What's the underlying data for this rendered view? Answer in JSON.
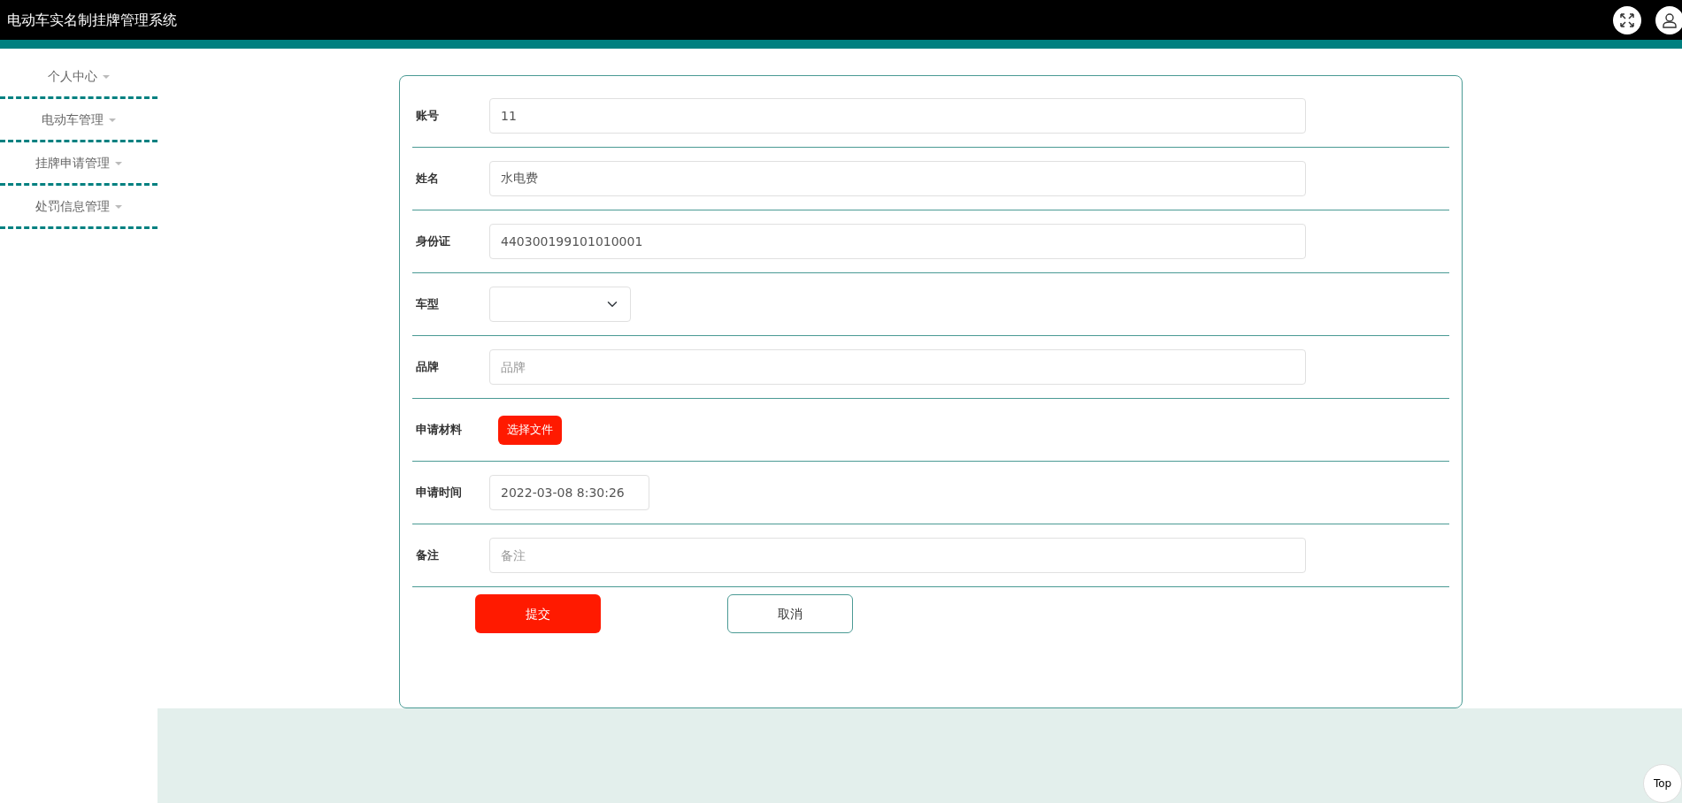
{
  "header": {
    "title": "电动车实名制挂牌管理系统"
  },
  "sidebar": {
    "items": [
      {
        "label": "个人中心"
      },
      {
        "label": "电动车管理"
      },
      {
        "label": "挂牌申请管理"
      },
      {
        "label": "处罚信息管理"
      }
    ]
  },
  "form": {
    "fields": [
      {
        "label": "账号",
        "kind": "text",
        "value": "11"
      },
      {
        "label": "姓名",
        "kind": "text",
        "value": "水电费"
      },
      {
        "label": "身份证",
        "kind": "text",
        "value": "440300199101010001"
      },
      {
        "label": "车型",
        "kind": "select"
      },
      {
        "label": "品牌",
        "kind": "text",
        "placeholder": "品牌"
      },
      {
        "label": "申请材料",
        "kind": "file",
        "button": "选择文件"
      },
      {
        "label": "申请时间",
        "kind": "date",
        "value": "2022-03-08 8:30:26"
      },
      {
        "label": "备注",
        "kind": "text",
        "placeholder": "备注"
      }
    ],
    "buttons": [
      {
        "label": "提交",
        "kind": "primary"
      },
      {
        "label": "取消",
        "kind": "secondary"
      }
    ]
  },
  "top_button": {
    "label": "Top"
  }
}
